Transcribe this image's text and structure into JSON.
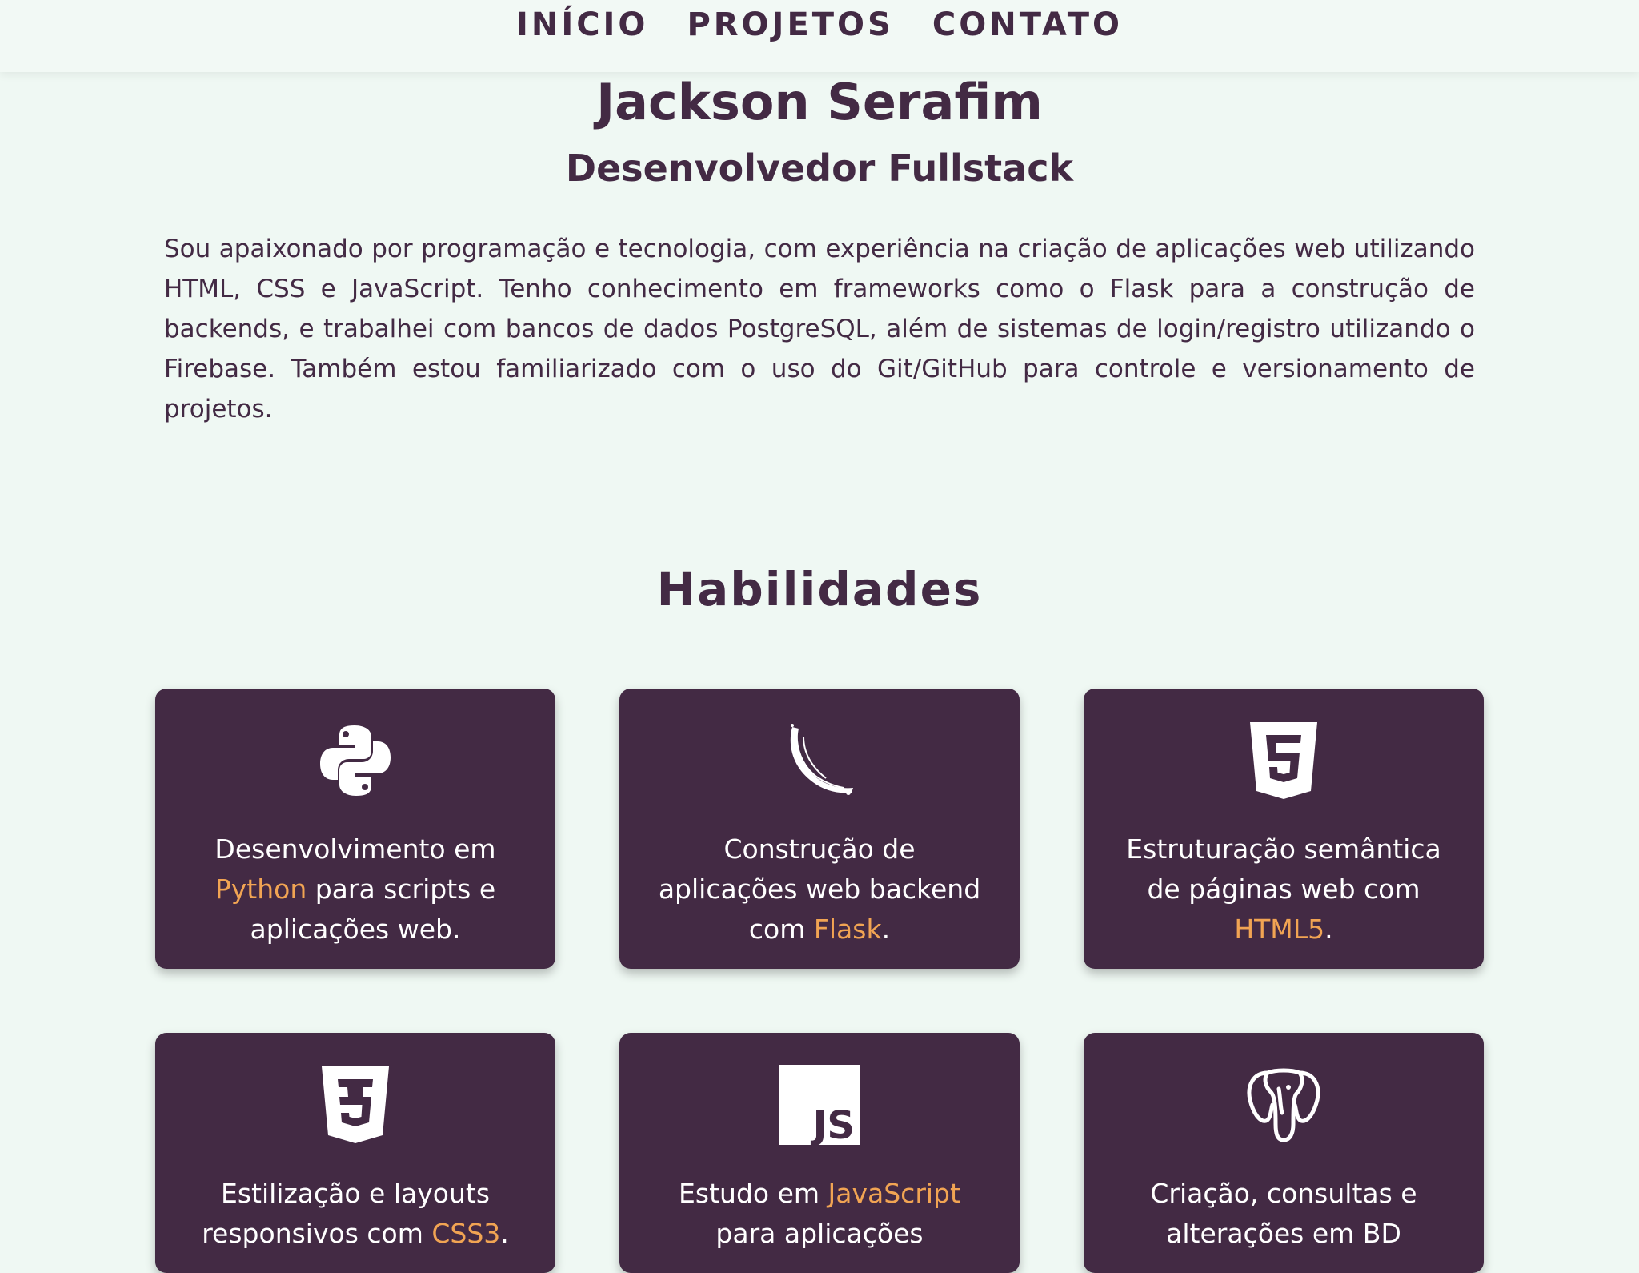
{
  "nav": {
    "items": [
      {
        "label": "INÍCIO"
      },
      {
        "label": "PROJETOS"
      },
      {
        "label": "CONTATO"
      }
    ]
  },
  "header": {
    "name": "Jackson Serafim",
    "role": "Desenvolvedor Fullstack",
    "about": "Sou apaixonado por programação e tecnologia, com experiência na criação de aplicações web utilizando HTML, CSS e JavaScript. Tenho conhecimento em frameworks como o Flask para a construção de backends, e trabalhei com bancos de dados PostgreSQL, além de sistemas de login/registro utilizando o Firebase. Também estou familiarizado com o uso do Git/GitHub para controle e versionamento de projetos."
  },
  "skills": {
    "title": "Habilidades",
    "accent_color": "#f1a453",
    "card_color": "#432a44",
    "cards": [
      {
        "icon": "python-icon",
        "pre": "Desenvolvimento em ",
        "tech": "Python",
        "post": " para scripts e aplicações web."
      },
      {
        "icon": "flask-icon",
        "pre": "Construção de aplicações web backend com ",
        "tech": "Flask",
        "post": "."
      },
      {
        "icon": "html5-icon",
        "pre": "Estruturação semântica de páginas web com ",
        "tech": "HTML5",
        "post": "."
      },
      {
        "icon": "css3-icon",
        "pre": "Estilização e layouts responsivos com ",
        "tech": "CSS3",
        "post": "."
      },
      {
        "icon": "javascript-icon",
        "pre": "Estudo em ",
        "tech": "JavaScript",
        "post": " para aplicações"
      },
      {
        "icon": "postgresql-icon",
        "pre": "Criação, consultas e alterações em BD",
        "tech": "",
        "post": ""
      }
    ]
  }
}
